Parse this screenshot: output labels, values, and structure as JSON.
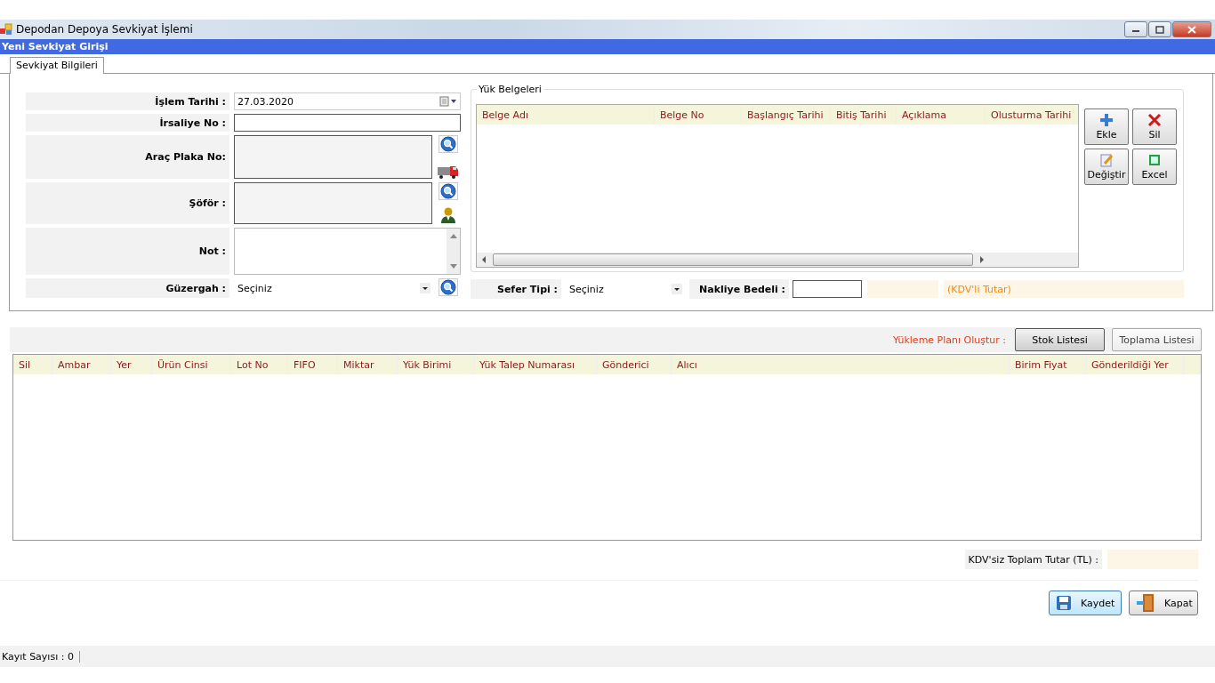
{
  "window": {
    "title": "Depodan Depoya Sevkiyat İşlemi"
  },
  "header": {
    "title": "Yeni Sevkiyat Girişi"
  },
  "tabs": [
    {
      "label": "Sevkiyat Bilgileri",
      "selected": true
    }
  ],
  "form": [
    {
      "kind": "date",
      "label": "İşlem Tarihi :",
      "value": "27.03.2020"
    },
    {
      "kind": "text",
      "label": "İrsaliye No :"
    },
    {
      "kind": "vehicle",
      "label": "Araç Plaka No:"
    },
    {
      "kind": "driver",
      "label": "Şöför :"
    },
    {
      "kind": "memo",
      "label": "Not :"
    },
    {
      "kind": "combo",
      "label": "Güzergah :",
      "value": "Seçiniz"
    }
  ],
  "documents": {
    "legend": "Yük Belgeleri",
    "columns": [
      "Belge Adı",
      "Belge No",
      "Başlangıç Tarihi",
      "Bitiş Tarihi",
      "Açıklama",
      "Olusturma Tarihi"
    ],
    "buttons": [
      {
        "kind": "add",
        "label": "Ekle"
      },
      {
        "kind": "delete",
        "label": "Sil"
      },
      {
        "kind": "edit",
        "label": "Değiştir"
      },
      {
        "kind": "excel",
        "label": "Excel"
      }
    ]
  },
  "trip": {
    "label": "Sefer Tipi :",
    "value": "Seçiniz"
  },
  "freight": {
    "label": "Nakliye Bedeli :",
    "total_label": "(KDV'li Tutar)"
  },
  "loading": {
    "label": "Yükleme Planı Oluştur :",
    "buttons": [
      {
        "label": "Stok Listesi",
        "selected": true
      },
      {
        "label": "Toplama Listesi",
        "selected": false
      }
    ]
  },
  "items_table": {
    "columns": [
      "Sil",
      "Ambar",
      "Yer",
      "Ürün Cinsi",
      "Lot No",
      "FIFO",
      "Miktar",
      "Yük Birimi",
      "Yük Talep Numarası",
      "Gönderici",
      "Alıcı",
      "Birim Fiyat",
      "Gönderildiği Yer"
    ]
  },
  "total": {
    "label": "KDV'siz Toplam Tutar (TL) :"
  },
  "actions": [
    {
      "kind": "save",
      "label": "Kaydet"
    },
    {
      "kind": "close",
      "label": "Kapat"
    }
  ],
  "status_bar": {
    "record_count": "Kayıt Sayısı : 0"
  }
}
